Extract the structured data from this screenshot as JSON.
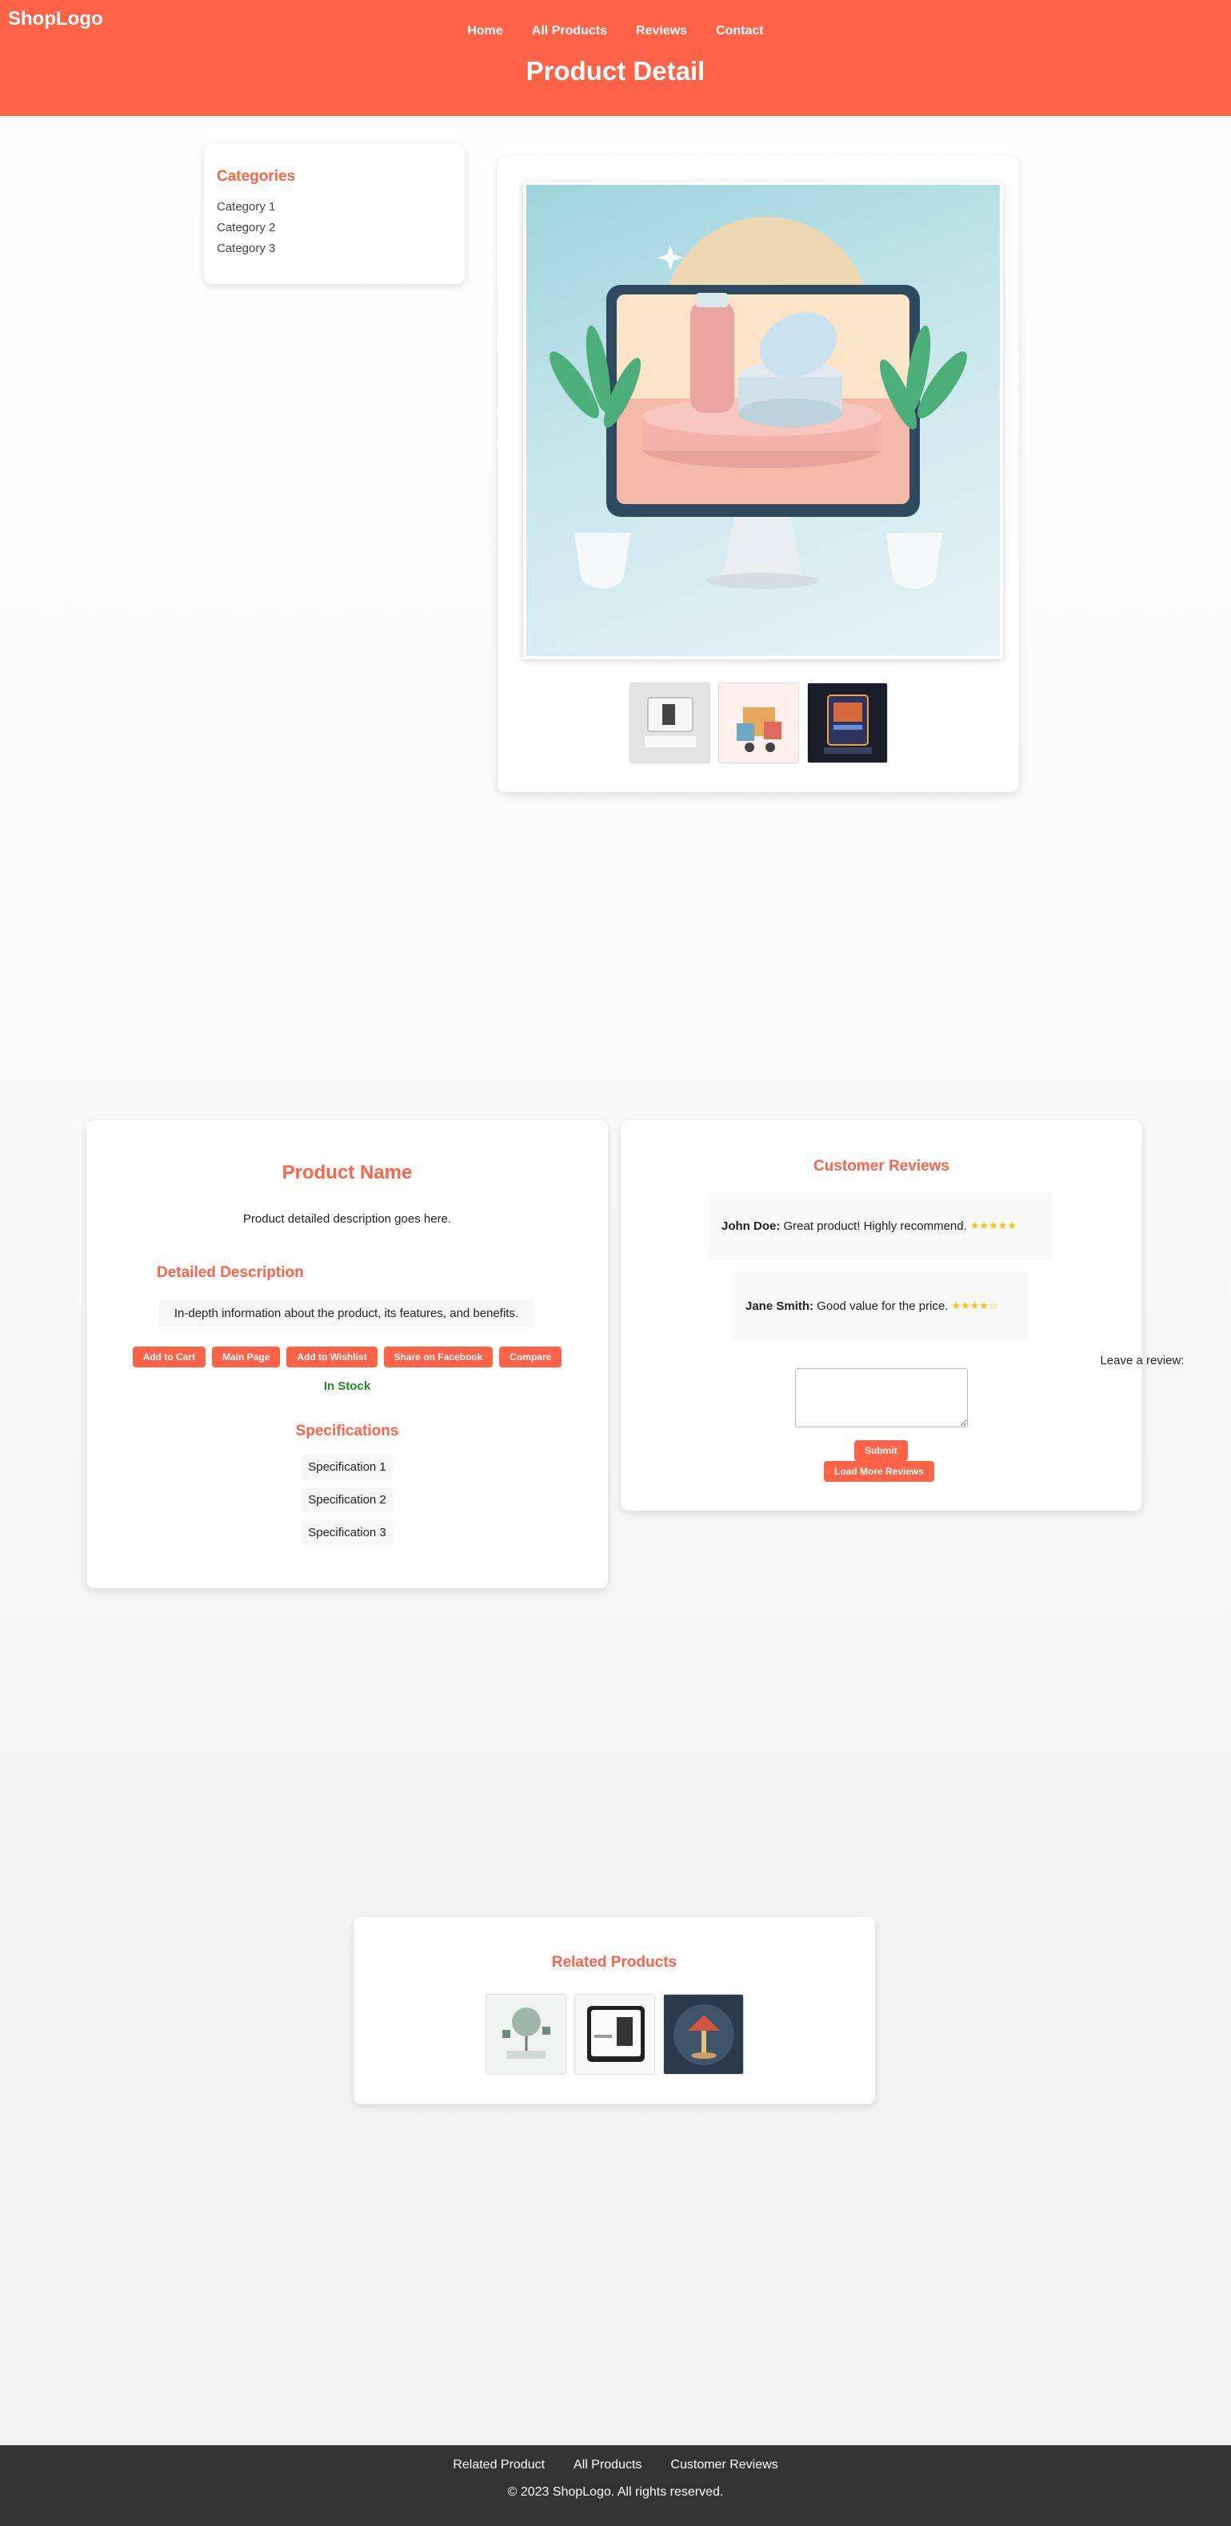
{
  "header": {
    "logo": "ShopLogo",
    "nav": [
      "Home",
      "All Products",
      "Reviews",
      "Contact"
    ],
    "title": "Product Detail"
  },
  "sidebar": {
    "title": "Categories",
    "items": [
      "Category 1",
      "Category 2",
      "Category 3"
    ]
  },
  "gallery": {
    "thumbnails": 3
  },
  "product": {
    "name": "Product Name",
    "description": "Product detailed description goes here.",
    "detailed_heading": "Detailed Description",
    "detailed_text": "In-depth information about the product, its features, and benefits.",
    "buttons": [
      "Add to Cart",
      "Main Page",
      "Add to Wishlist",
      "Share on Facebook",
      "Compare"
    ],
    "stock": "In Stock",
    "spec_heading": "Specifications",
    "specs": [
      "Specification 1",
      "Specification 2",
      "Specification 3"
    ]
  },
  "reviews": {
    "title": "Customer Reviews",
    "items": [
      {
        "author": "John Doe:",
        "text": "Great product! Highly recommend.",
        "stars": "★★★★★"
      },
      {
        "author": "Jane Smith:",
        "text": "Good value for the price.",
        "stars": "★★★★☆"
      }
    ],
    "leave_label": "Leave a review:",
    "submit": "Submit",
    "load_more": "Load More Reviews"
  },
  "related": {
    "title": "Related Products"
  },
  "footer": {
    "links": [
      "Related Product",
      "All Products",
      "Customer Reviews"
    ],
    "copyright": "© 2023 ShopLogo. All rights reserved."
  },
  "colors": {
    "accent": "#ff6347",
    "stock": "#228b22",
    "stars": "#ffc107",
    "footer": "#333333"
  }
}
